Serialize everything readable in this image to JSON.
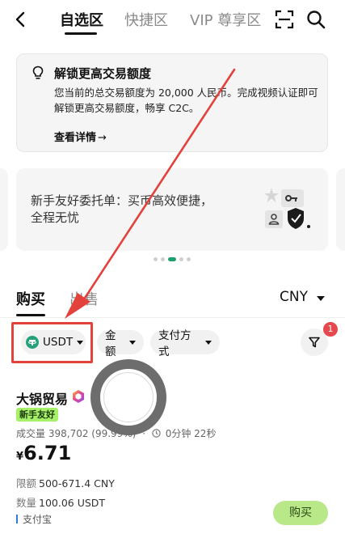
{
  "nav": {
    "tabs": [
      "自选区",
      "快捷区",
      "VIP 尊享区"
    ],
    "active_tab": "自选区"
  },
  "notice": {
    "title": "解锁更高交易额度",
    "body": "您当前的总交易额度为 20,000 人民币。完成视频认证即可解锁更高交易额度，畅享 C2C。",
    "link": "查看详情",
    "link_arrow": "→"
  },
  "promo": {
    "text": "新手友好委托单：买币高效便捷，全程无忧"
  },
  "carousel": {
    "count": 5,
    "active_index": 2
  },
  "trade": {
    "buy_label": "购买",
    "sell_label": "出售",
    "currency": "CNY"
  },
  "filters": {
    "coin": "USDT",
    "amount": "金额",
    "payment": "支付方式",
    "badge_count": "1"
  },
  "listing": {
    "merchant": "大锅贸易",
    "tag": "新手友好",
    "volume_label": "成交量",
    "volume": "398,702 (99.99%)",
    "separator": "·",
    "time": "0分钟 22秒",
    "price_symbol": "¥",
    "price": "6.71",
    "limit_label": "限额",
    "limit": "500-671.4 CNY",
    "qty_label": "数量",
    "qty": "100.06 USDT",
    "payment_method": "支付宝",
    "buy_button": "购买"
  },
  "colors": {
    "accent_green": "#1f9e6e",
    "tag_green": "#a7f06a",
    "buy_button": "#b9e889",
    "annotation_red": "#e3413c",
    "badge_red": "#e5484d"
  },
  "icons": {
    "back": "chevron-left-icon",
    "scan": "scan-icon",
    "search": "search-icon",
    "bulb": "lightbulb-icon",
    "filter": "filter-icon",
    "coin": "usdt-coin-icon"
  }
}
